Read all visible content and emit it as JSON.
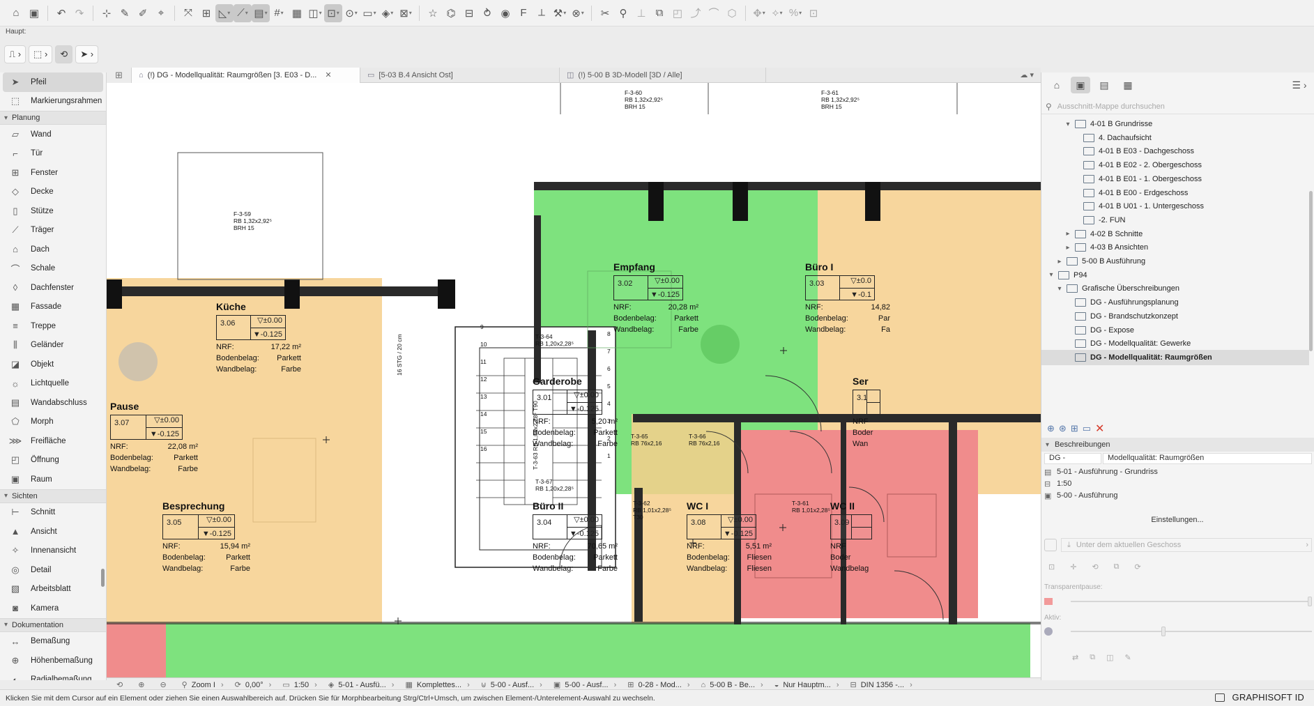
{
  "toolbar": {
    "icons": [
      "home-icon",
      "save-icon",
      "undo-icon",
      "redo-icon",
      "pick-up-icon",
      "eyedropper-icon",
      "inject-icon",
      "paint-icon",
      "fit-icon",
      "elevation-marker-icon",
      "guide-line-icon",
      "snap-guide-icon",
      "layer-combo-icon",
      "grid-snap-icon",
      "gravity-icon",
      "cursor-snap-icon",
      "lock-icon",
      "group-icon",
      "suspend-group-icon",
      "layer-icon",
      "3d-walk-icon",
      "favorite-icon",
      "section-icon",
      "view-icon",
      "link-icon",
      "detail-icon",
      "rename-icon",
      "measure-icon",
      "magic-wand-icon",
      "renovation-icon",
      "trim-icon",
      "split-icon",
      "adjust-icon",
      "offset-icon",
      "curve-icon",
      "drag-icon",
      "rotate-icon",
      "mirror-icon",
      "elevate-icon",
      "resize-icon",
      "more-icon"
    ]
  },
  "info_label": "Haupt:",
  "toolbox": {
    "items": [
      {
        "type": "tool",
        "label": "Pfeil",
        "icon": "arrow-icon",
        "selected": true
      },
      {
        "type": "tool",
        "label": "Markierungsrahmen",
        "icon": "marquee-icon"
      },
      {
        "type": "group",
        "label": "Planung"
      },
      {
        "type": "tool",
        "label": "Wand",
        "icon": "wall-icon"
      },
      {
        "type": "tool",
        "label": "Tür",
        "icon": "door-icon"
      },
      {
        "type": "tool",
        "label": "Fenster",
        "icon": "window-icon"
      },
      {
        "type": "tool",
        "label": "Decke",
        "icon": "slab-icon"
      },
      {
        "type": "tool",
        "label": "Stütze",
        "icon": "column-icon"
      },
      {
        "type": "tool",
        "label": "Träger",
        "icon": "beam-icon"
      },
      {
        "type": "tool",
        "label": "Dach",
        "icon": "roof-icon"
      },
      {
        "type": "tool",
        "label": "Schale",
        "icon": "shell-icon"
      },
      {
        "type": "tool",
        "label": "Dachfenster",
        "icon": "skylight-icon"
      },
      {
        "type": "tool",
        "label": "Fassade",
        "icon": "curtain-wall-icon"
      },
      {
        "type": "tool",
        "label": "Treppe",
        "icon": "stair-icon"
      },
      {
        "type": "tool",
        "label": "Geländer",
        "icon": "railing-icon"
      },
      {
        "type": "tool",
        "label": "Objekt",
        "icon": "object-icon"
      },
      {
        "type": "tool",
        "label": "Lichtquelle",
        "icon": "lamp-icon"
      },
      {
        "type": "tool",
        "label": "Wandabschluss",
        "icon": "wall-end-icon"
      },
      {
        "type": "tool",
        "label": "Morph",
        "icon": "morph-icon"
      },
      {
        "type": "tool",
        "label": "Freifläche",
        "icon": "mesh-icon"
      },
      {
        "type": "tool",
        "label": "Öffnung",
        "icon": "opening-icon"
      },
      {
        "type": "tool",
        "label": "Raum",
        "icon": "zone-icon"
      },
      {
        "type": "group",
        "label": "Sichten"
      },
      {
        "type": "tool",
        "label": "Schnitt",
        "icon": "section-tool-icon"
      },
      {
        "type": "tool",
        "label": "Ansicht",
        "icon": "elevation-tool-icon"
      },
      {
        "type": "tool",
        "label": "Innenansicht",
        "icon": "interior-elevation-icon"
      },
      {
        "type": "tool",
        "label": "Detail",
        "icon": "detail-tool-icon"
      },
      {
        "type": "tool",
        "label": "Arbeitsblatt",
        "icon": "worksheet-icon"
      },
      {
        "type": "tool",
        "label": "Kamera",
        "icon": "camera-icon"
      },
      {
        "type": "group",
        "label": "Dokumentation"
      },
      {
        "type": "tool",
        "label": "Bemaßung",
        "icon": "dimension-icon"
      },
      {
        "type": "tool",
        "label": "Höhenbemaßung",
        "icon": "level-dimension-icon"
      },
      {
        "type": "tool",
        "label": "Radialbemaßung",
        "icon": "radial-dimension-icon"
      }
    ]
  },
  "tabs": [
    {
      "label": "(!) DG - Modellqualität: Raumgrößen [3. E03 - D...",
      "active": true,
      "close": "✕"
    },
    {
      "label": "[5-03 B.4 Ansicht Ost]",
      "active": false
    },
    {
      "label": "(!) 5-00 B 3D-Modell [3D / Alle]",
      "active": false
    }
  ],
  "plan": {
    "colors": {
      "green": "#7ee27e",
      "orange": "#f6cf8c",
      "red": "#f08c8c",
      "wall": "#2a2a2a"
    },
    "rooms": [
      {
        "key": "kueche",
        "name": "Küche",
        "number": "3.06",
        "top": "▽±0.00",
        "bottom": "▼-0.125",
        "nrf_label": "NRF:",
        "nrf": "17,22 m²",
        "floor_label": "Bodenbelag:",
        "floor": "Parkett",
        "wall_label": "Wandbelag:",
        "wall": "Farbe"
      },
      {
        "key": "pause",
        "name": "Pause",
        "number": "3.07",
        "top": "▽±0.00",
        "bottom": "▼-0.125",
        "nrf_label": "NRF:",
        "nrf": "22,08 m²",
        "floor_label": "Bodenbelag:",
        "floor": "Parkett",
        "wall_label": "Wandbelag:",
        "wall": "Farbe"
      },
      {
        "key": "empfang",
        "name": "Empfang",
        "number": "3.02",
        "top": "▽±0.00",
        "bottom": "▼-0.125",
        "nrf_label": "NRF:",
        "nrf": "20,28 m²",
        "floor_label": "Bodenbelag:",
        "floor": "Parkett",
        "wall_label": "Wandbelag:",
        "wall": "Farbe"
      },
      {
        "key": "buero1",
        "name": "Büro I",
        "number": "3.03",
        "top": "▽±0.0",
        "bottom": "▼-0.1",
        "nrf_label": "NRF:",
        "nrf": "14,82",
        "floor_label": "Bodenbelag:",
        "floor": "Par",
        "wall_label": "Wandbelag:",
        "wall": "Fa"
      },
      {
        "key": "garderobe",
        "name": "Garderobe",
        "number": "3.01",
        "top": "▽±0.00",
        "bottom": "▼-0.125",
        "nrf_label": "NRF:",
        "nrf": "5,20 m²",
        "floor_label": "Bodenbelag:",
        "floor": "Parkett",
        "wall_label": "Wandbelag:",
        "wall": "Farbe"
      },
      {
        "key": "besprechung",
        "name": "Besprechung",
        "number": "3.05",
        "top": "▽±0.00",
        "bottom": "▼-0.125",
        "nrf_label": "NRF:",
        "nrf": "15,94 m²",
        "floor_label": "Bodenbelag:",
        "floor": "Parkett",
        "wall_label": "Wandbelag:",
        "wall": "Farbe"
      },
      {
        "key": "buero2",
        "name": "Büro II",
        "number": "3.04",
        "top": "▽±0.00",
        "bottom": "▼-0.125",
        "nrf_label": "NRF:",
        "nrf": "70,65 m²",
        "floor_label": "Bodenbelag:",
        "floor": "Parkett",
        "wall_label": "Wandbelag:",
        "wall": "Farbe"
      },
      {
        "key": "wc1",
        "name": "WC I",
        "number": "3.08",
        "top": "▽±0.00",
        "bottom": "▼-0.125",
        "nrf_label": "NRF:",
        "nrf": "5,51 m²",
        "floor_label": "Bodenbelag:",
        "floor": "Fliesen",
        "wall_label": "Wandbelag:",
        "wall": "Fliesen"
      },
      {
        "key": "wc2",
        "name": "WC II",
        "number": "3.09",
        "top": "",
        "bottom": "",
        "nrf_label": "NRF",
        "nrf": "",
        "floor_label": "Boder",
        "floor": "",
        "wall_label": "Wandbelag",
        "wall": ""
      },
      {
        "key": "ser",
        "name": "Ser",
        "number": "3.1",
        "top": "",
        "bottom": "",
        "nrf_label": "NRF",
        "nrf": "",
        "floor_label": "Boder",
        "floor": "",
        "wall_label": "Wan",
        "wall": ""
      }
    ],
    "windows": [
      {
        "key": "f359",
        "lines": [
          "F-3-59",
          "RB    1,32x2,92⁵",
          "BRH  15"
        ]
      },
      {
        "key": "f360",
        "lines": [
          "F-3-60",
          "RB    1,32x2,92⁵",
          "BRH  15"
        ]
      },
      {
        "key": "f361",
        "lines": [
          "F-3-61",
          "RB    1,32x2,92⁵",
          "BRH  15"
        ]
      }
    ],
    "doors": [
      {
        "key": "t364",
        "lines": [
          "T-3-64",
          "RB  1,20x2,28⁵"
        ]
      },
      {
        "key": "t365",
        "lines": [
          "T-3-65",
          "RB  76x2,16"
        ]
      },
      {
        "key": "t366",
        "lines": [
          "T-3-66",
          "RB  76x2,16"
        ]
      },
      {
        "key": "t367",
        "lines": [
          "T-3-67",
          "RB  1,20x2,28⁵"
        ]
      },
      {
        "key": "t362",
        "lines": [
          "T-3-62",
          "RB  1,01x2,28⁵",
          "T30"
        ]
      },
      {
        "key": "t361",
        "lines": [
          "T-3-61",
          "RB  1,01x2,28⁵",
          "T30"
        ]
      }
    ],
    "stair_text": "16 STG / 20 cm",
    "stair_side": "T-3-63  RB 1,01x2,28⁵  T90",
    "stair_numbers": [
      "9",
      "10",
      "11",
      "12",
      "13",
      "14",
      "15",
      "16",
      "8",
      "7",
      "6",
      "5",
      "4",
      "3",
      "2",
      "1"
    ]
  },
  "navigator": {
    "search_placeholder": "Ausschnitt-Mappe durchsuchen",
    "tree": [
      {
        "label": "4-01 B Grundrisse",
        "level": 3,
        "arrow": "▾",
        "folder": true
      },
      {
        "label": "4. Dachaufsicht",
        "level": 4,
        "arrow": ""
      },
      {
        "label": "4-01 B E03 - Dachgeschoss",
        "level": 4,
        "arrow": ""
      },
      {
        "label": "4-01 B E02 - 2. Obergeschoss",
        "level": 4,
        "arrow": ""
      },
      {
        "label": "4-01 B E01 - 1. Obergeschoss",
        "level": 4,
        "arrow": ""
      },
      {
        "label": "4-01 B E00 - Erdgeschoss",
        "level": 4,
        "arrow": ""
      },
      {
        "label": "4-01 B U01 - 1. Untergeschoss",
        "level": 4,
        "arrow": ""
      },
      {
        "label": "-2. FUN",
        "level": 4,
        "arrow": ""
      },
      {
        "label": "4-02 B Schnitte",
        "level": 3,
        "arrow": "▸",
        "folder": true
      },
      {
        "label": "4-03 B Ansichten",
        "level": 3,
        "arrow": "▸",
        "folder": true
      },
      {
        "label": "5-00 B Ausführung",
        "level": 2,
        "arrow": "▸",
        "folder": true
      },
      {
        "label": "P94",
        "level": 1,
        "arrow": "▾",
        "folder": true
      },
      {
        "label": "Grafische Überschreibungen",
        "level": 2,
        "arrow": "▾",
        "folder": true
      },
      {
        "label": "DG - Ausführungsplanung",
        "level": 3,
        "arrow": ""
      },
      {
        "label": "DG - Brandschutzkonzept",
        "level": 3,
        "arrow": ""
      },
      {
        "label": "DG - Expose",
        "level": 3,
        "arrow": ""
      },
      {
        "label": "DG - Modellqualität: Gewerke",
        "level": 3,
        "arrow": ""
      },
      {
        "label": "DG - Modellqualität: Raumgrößen",
        "level": 3,
        "arrow": "",
        "selected": true
      }
    ],
    "section_title": "Beschreibungen",
    "id_prefix": "DG -",
    "id_name": "Modellqualität: Raumgrößen",
    "props": [
      {
        "icon": "layer-combo-icon",
        "label": "5-01 - Ausführung - Grundriss"
      },
      {
        "icon": "scale-icon",
        "label": "1:50"
      },
      {
        "icon": "model-view-icon",
        "label": "5-00 - Ausführung"
      }
    ],
    "settings_button": "Einstellungen...",
    "story_placeholder": "Unter dem aktuellen Geschoss",
    "transparency_label": "Transparentpause:",
    "active_label": "Aktiv:"
  },
  "bottombar": [
    {
      "icon": "undo-zoom-icon",
      "label": ""
    },
    {
      "icon": "zoom-in-icon",
      "label": ""
    },
    {
      "icon": "zoom-out-icon",
      "label": ""
    },
    {
      "icon": "zoom-value-icon",
      "label": "Zoom I"
    },
    {
      "icon": "rotate-icon",
      "label": "0,00°"
    },
    {
      "icon": "scale-icon",
      "label": "1:50"
    },
    {
      "icon": "layer-icon",
      "label": "5-01 - Ausfü..."
    },
    {
      "icon": "pen-icon",
      "label": "Komplettes..."
    },
    {
      "icon": "model-view-icon",
      "label": "5-00 - Ausf..."
    },
    {
      "icon": "dimension-icon",
      "label": "5-00 - Ausf..."
    },
    {
      "icon": "override-icon",
      "label": "0-28 - Mod..."
    },
    {
      "icon": "renovation-icon",
      "label": "5-00 B - Be..."
    },
    {
      "icon": "structure-icon",
      "label": "Nur Hauptm..."
    },
    {
      "icon": "standard-icon",
      "label": "DIN 1356 -..."
    }
  ],
  "status_text": "Klicken Sie mit dem Cursor auf ein Element oder ziehen Sie einen Auswahlbereich auf. Drücken Sie für Morphbearbeitung Strg/Ctrl+Umsch, um zwischen Element-/Unterelement-Auswahl zu wechseln.",
  "brand": "GRAPHISOFT ID"
}
